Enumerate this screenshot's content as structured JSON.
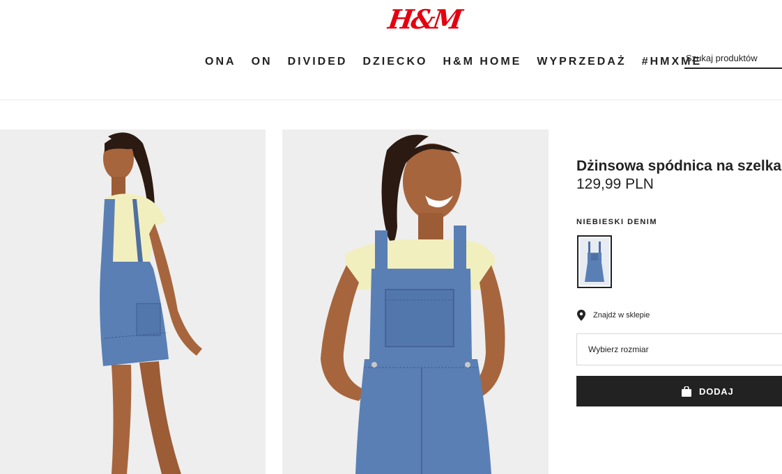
{
  "header": {
    "logo_text": "H&M",
    "nav": [
      "ONA",
      "ON",
      "DIVIDED",
      "DZIECKO",
      "H&M HOME",
      "WYPRZEDAŻ",
      "#HMXME"
    ],
    "search_placeholder": "Szukaj produktów"
  },
  "product": {
    "title": "Dżinsowa spódnica na szelkach",
    "price": "129,99 PLN",
    "color_label": "NIEBIESKI DENIM",
    "store_link": "Znajdź w sklepie",
    "size_select": "Wybierz rozmiar",
    "add_button": "DODAJ"
  },
  "colors": {
    "brand": "#e50010",
    "text": "#222222",
    "denim": "#5a7fb5",
    "image_bg": "#eeeeee"
  },
  "icons": {
    "store": "map-pin-icon",
    "bag": "shopping-bag-icon"
  }
}
